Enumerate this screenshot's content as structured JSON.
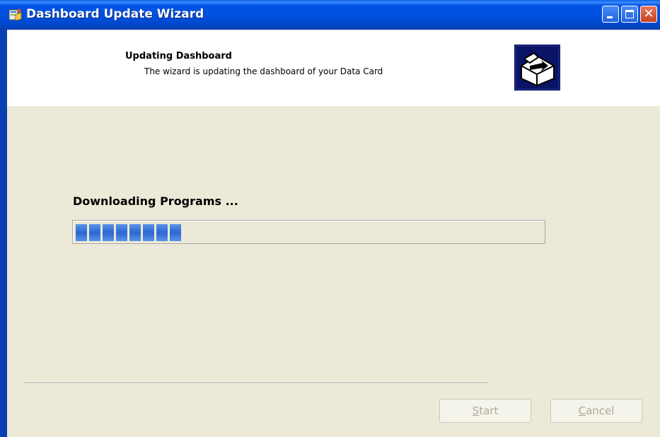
{
  "window": {
    "title": "Dashboard Update Wizard",
    "icon": "wizard-app-icon",
    "controls": {
      "minimize": "minimize-icon",
      "maximize": "maximize-icon",
      "close": "close-icon"
    }
  },
  "header": {
    "title": "Updating Dashboard",
    "subtitle": "The wizard is updating the dashboard of your Data Card",
    "icon": "install-box-icon"
  },
  "status": {
    "label": "Downloading Programs ..."
  },
  "progress": {
    "blocks_filled": 8,
    "percent_estimate": 25
  },
  "buttons": {
    "start": {
      "prefix": "",
      "accel": "S",
      "rest": "tart",
      "enabled": false
    },
    "cancel": {
      "prefix": "",
      "accel": "C",
      "rest": "ancel",
      "enabled": false
    }
  },
  "colors": {
    "titlebar": "#0054E3",
    "dialog_bg": "#ECE9D8",
    "progress_block": "#2F6BD2",
    "disabled_text": "#ACA899"
  }
}
